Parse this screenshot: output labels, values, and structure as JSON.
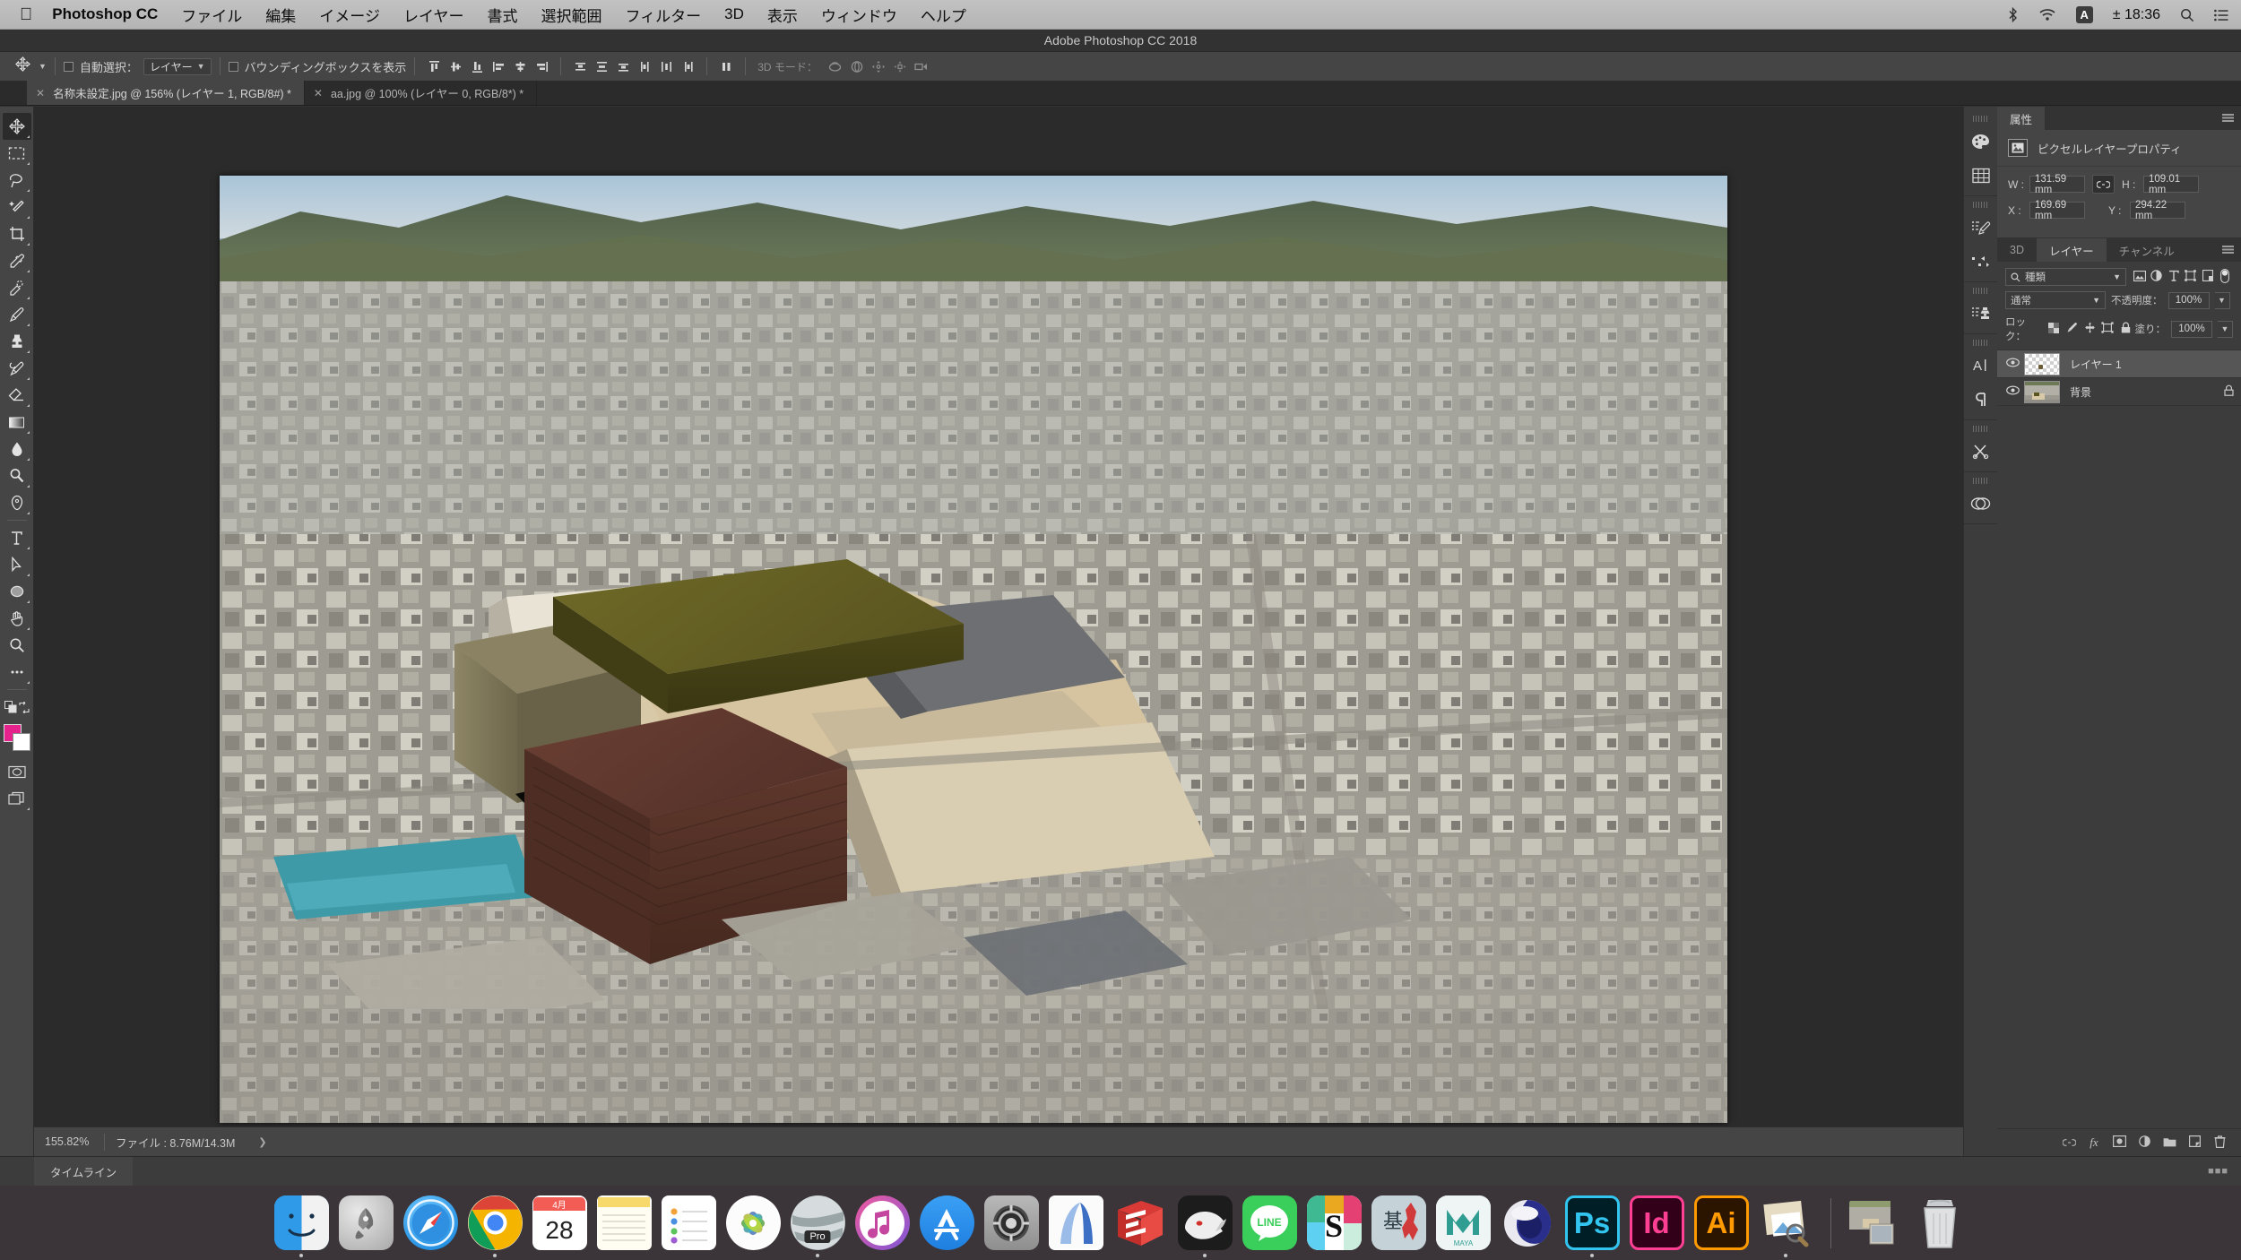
{
  "macbar": {
    "apple_icon": "apple-logo",
    "app_name": "Photoshop CC",
    "menus": [
      "ファイル",
      "編集",
      "イメージ",
      "レイヤー",
      "書式",
      "選択範囲",
      "フィルター",
      "3D",
      "表示",
      "ウィンドウ",
      "ヘルプ"
    ],
    "status": {
      "bluetooth_icon": "bluetooth-icon",
      "wifi_icon": "wifi-icon",
      "input_source": "A",
      "clock": "± 18:36",
      "search_icon": "search-icon",
      "notification_icon": "notification-center-icon"
    }
  },
  "window": {
    "title": "Adobe Photoshop CC 2018"
  },
  "options_bar": {
    "tool_icon": "move-tool-icon",
    "auto_select_label": "自動選択：",
    "auto_select_value": "レイヤー",
    "show_bounding_box_label": "バウンディングボックスを表示",
    "mode3d_label": "3D モード：",
    "align_icons": [
      "align-top-edges-icon",
      "align-vertical-centers-icon",
      "align-bottom-edges-icon",
      "align-left-edges-icon",
      "align-horizontal-centers-icon",
      "align-right-edges-icon"
    ],
    "distribute_icons": [
      "distribute-top-edges-icon",
      "distribute-vertical-centers-icon",
      "distribute-bottom-edges-icon",
      "distribute-left-edges-icon",
      "distribute-horizontal-centers-icon",
      "distribute-right-edges-icon"
    ],
    "distribute_spacing_icon": "distribute-spacing-icon",
    "mode3d_icons": [
      "rotate-3d-icon",
      "roll-3d-icon",
      "pan-3d-icon",
      "slide-3d-icon",
      "scale-3d-icon"
    ]
  },
  "tabs": [
    {
      "close_icon": "close-icon",
      "label": "名称未設定.jpg @ 156% (レイヤー 1, RGB/8#) *",
      "active": true
    },
    {
      "close_icon": "close-icon",
      "label": "aa.jpg @ 100% (レイヤー 0, RGB/8*) *",
      "active": false
    }
  ],
  "toolbar": {
    "tools": [
      {
        "name": "move-tool",
        "selected": true
      },
      {
        "name": "rectangular-marquee-tool",
        "selected": false
      },
      {
        "name": "lasso-tool",
        "selected": false
      },
      {
        "name": "magic-wand-tool",
        "selected": false
      },
      {
        "name": "crop-tool",
        "selected": false
      },
      {
        "name": "eyedropper-tool",
        "selected": false
      },
      {
        "name": "spot-healing-brush-tool",
        "selected": false
      },
      {
        "name": "brush-tool",
        "selected": false
      },
      {
        "name": "clone-stamp-tool",
        "selected": false
      },
      {
        "name": "history-brush-tool",
        "selected": false
      },
      {
        "name": "eraser-tool",
        "selected": false
      },
      {
        "name": "gradient-tool",
        "selected": false
      },
      {
        "name": "blur-tool",
        "selected": false
      },
      {
        "name": "dodge-tool",
        "selected": false
      },
      {
        "name": "pen-tool",
        "selected": false
      },
      {
        "name": "horizontal-type-tool",
        "selected": false
      },
      {
        "name": "path-selection-tool",
        "selected": false
      },
      {
        "name": "ellipse-shape-tool",
        "selected": false
      },
      {
        "name": "hand-tool",
        "selected": false
      },
      {
        "name": "zoom-tool",
        "selected": false
      },
      {
        "name": "edit-toolbar-tool",
        "selected": false
      }
    ],
    "quick_mask_icon": "quick-mask-icon",
    "screen_mode_icon": "screen-mode-icon",
    "swap_colors_icon": "swap-colors-icon",
    "default_colors_icon": "default-colors-icon",
    "foreground_color": "#e6228c",
    "background_color": "#ffffff"
  },
  "panel_rail": [
    "color-panel-icon",
    "swatches-panel-icon",
    "brush-settings-panel-icon",
    "brush-presets-panel-icon",
    "clone-source-panel-icon",
    "character-panel-icon",
    "paragraph-panel-icon",
    "tool-presets-panel-icon",
    "creative-cloud-libraries-panel-icon"
  ],
  "properties": {
    "tab_label": "属性",
    "menu_icon": "panel-menu-icon",
    "layer_type_icon": "pixel-layer-icon",
    "header": "ピクセルレイヤープロパティ",
    "fields": [
      {
        "key": "W :",
        "value": "131.59 mm"
      },
      {
        "key": "H :",
        "value": "109.01 mm"
      },
      {
        "key": "X :",
        "value": "169.69 mm"
      },
      {
        "key": "Y :",
        "value": "294.22 mm"
      }
    ],
    "link_icon": "link-dimensions-icon"
  },
  "layers_panel": {
    "tabs": [
      {
        "label": "3D",
        "active": false
      },
      {
        "label": "レイヤー",
        "active": true
      },
      {
        "label": "チャンネル",
        "active": false
      }
    ],
    "menu_icon": "panel-menu-icon",
    "filter_icon": "search-icon",
    "filter_value": "種類",
    "filter_type_icons": [
      "filter-pixel-icon",
      "filter-adjustment-icon",
      "filter-type-icon",
      "filter-shape-icon",
      "filter-smart-object-icon"
    ],
    "filter_toggle_icon": "filter-toggle-icon",
    "blend_mode": "通常",
    "opacity_label": "不透明度：",
    "opacity_value": "100%",
    "lock_label": "ロック：",
    "lock_icons": [
      "lock-transparent-pixels-icon",
      "lock-image-pixels-icon",
      "lock-position-icon",
      "lock-artboard-nesting-icon",
      "lock-all-icon"
    ],
    "fill_label": "塗り：",
    "fill_value": "100%",
    "layers": [
      {
        "visible": true,
        "visibility_icon": "eye-icon",
        "name": "レイヤー 1",
        "thumb": "transparent",
        "selected": true,
        "locked": false
      },
      {
        "visible": true,
        "visibility_icon": "eye-icon",
        "name": "背景",
        "thumb": "photo",
        "selected": false,
        "locked": true,
        "lock_icon": "lock-icon"
      }
    ],
    "footer_icons": [
      "link-layers-icon",
      "layer-style-icon",
      "layer-mask-icon",
      "new-fill-adjustment-layer-icon",
      "new-group-icon",
      "new-layer-icon",
      "delete-layer-icon"
    ]
  },
  "status_bar": {
    "zoom": "155.82%",
    "doc_info": "ファイル : 8.76M/14.3M",
    "expand_icon": "chevron-right-icon"
  },
  "timeline": {
    "tab_label": "タイムライン",
    "grip_icon": "panel-grip-icon"
  },
  "canvas": {
    "description": "航空写真の市街地（建物モデル配置）"
  },
  "dock": {
    "items": [
      {
        "name": "Finder",
        "running": true
      },
      {
        "name": "Launchpad",
        "running": false
      },
      {
        "name": "Safari",
        "running": false
      },
      {
        "name": "Google Chrome",
        "running": true
      },
      {
        "name": "カレンダー",
        "running": false,
        "badge_month": "4月",
        "badge_day": "28"
      },
      {
        "name": "メモ",
        "running": false
      },
      {
        "name": "リマインダー",
        "running": false
      },
      {
        "name": "写真",
        "running": false
      },
      {
        "name": "Google Earth Pro",
        "running": true,
        "label": "Pro"
      },
      {
        "name": "iTunes",
        "running": false
      },
      {
        "name": "App Store",
        "running": false
      },
      {
        "name": "システム環境設定",
        "running": false
      },
      {
        "name": "ArchiCAD",
        "running": false
      },
      {
        "name": "SketchUp",
        "running": false
      },
      {
        "name": "Rhinoceros",
        "running": true
      },
      {
        "name": "LINE",
        "running": false,
        "label": "LINE"
      },
      {
        "name": "Slack",
        "running": false,
        "label": "S"
      },
      {
        "name": "基盤地図情報",
        "running": false,
        "label": "基"
      },
      {
        "name": "Maya",
        "running": false,
        "label": "MAYA"
      },
      {
        "name": "Cinema 4D",
        "running": false
      },
      {
        "name": "Adobe Photoshop CC",
        "running": true,
        "label": "Ps"
      },
      {
        "name": "Adobe InDesign CC",
        "running": false,
        "label": "Id"
      },
      {
        "name": "Adobe Illustrator CC",
        "running": false,
        "label": "Ai"
      },
      {
        "name": "プレビュー",
        "running": true
      },
      {
        "name": "ダウンロードスタック",
        "running": false
      },
      {
        "name": "ゴミ箱",
        "running": false
      }
    ]
  }
}
